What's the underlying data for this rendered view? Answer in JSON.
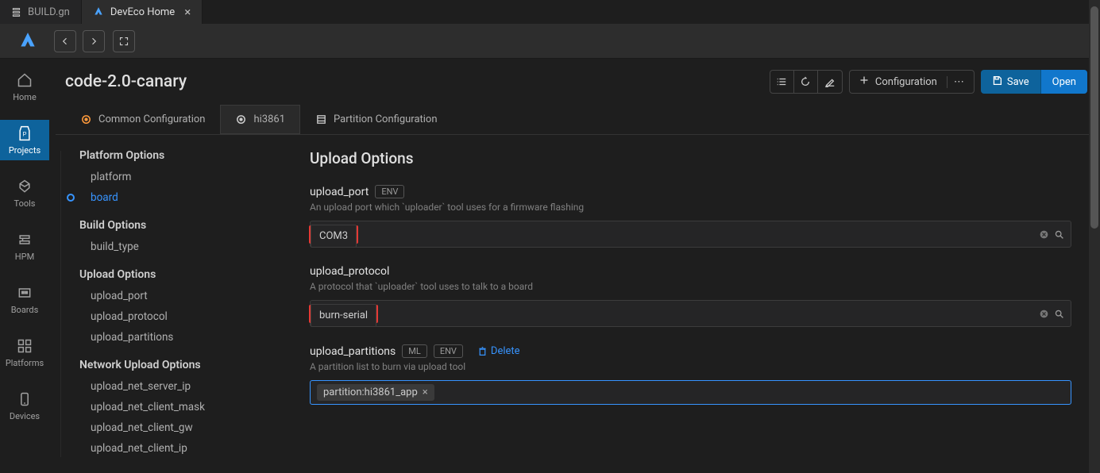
{
  "tabs": {
    "build": "BUILD.gn",
    "deveco": "DevEco Home"
  },
  "page": {
    "title": "code-2.0-canary",
    "config_label": "Configuration",
    "save_label": "Save",
    "open_label": "Open"
  },
  "config_tabs": {
    "common": "Common Configuration",
    "board": "hi3861",
    "partition": "Partition Configuration"
  },
  "sidebar": {
    "home": "Home",
    "projects": "Projects",
    "tools": "Tools",
    "hpm": "HPM",
    "boards": "Boards",
    "platforms": "Platforms",
    "devices": "Devices"
  },
  "opts": {
    "platform_group": "Platform Options",
    "platform": "platform",
    "board": "board",
    "build_group": "Build Options",
    "build_type": "build_type",
    "upload_group": "Upload Options",
    "upload_port": "upload_port",
    "upload_protocol": "upload_protocol",
    "upload_partitions": "upload_partitions",
    "network_group": "Network Upload Options",
    "server_ip": "upload_net_server_ip",
    "client_mask": "upload_net_client_mask",
    "client_gw": "upload_net_client_gw",
    "client_ip": "upload_net_client_ip"
  },
  "form": {
    "section_title": "Upload Options",
    "env_label": "ENV",
    "ml_label": "ML",
    "delete_label": "Delete",
    "upload_port": {
      "label": "upload_port",
      "desc": "An upload port which `uploader` tool uses for a firmware flashing",
      "value": "COM3"
    },
    "upload_protocol": {
      "label": "upload_protocol",
      "desc": "A protocol that `uploader` tool uses to talk to a board",
      "value": "burn-serial"
    },
    "upload_partitions": {
      "label": "upload_partitions",
      "desc": "A partition list to burn via upload tool",
      "tag": "partition:hi3861_app"
    }
  }
}
